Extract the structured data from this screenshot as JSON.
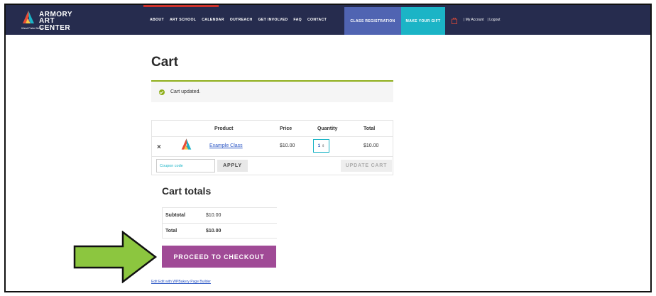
{
  "header": {
    "logo_line1": "ARMORY",
    "logo_line2": "ART CENTER",
    "logo_sub": "West Palm Beach",
    "nav": [
      "ABOUT",
      "ART SCHOOL",
      "CALENDAR",
      "OUTREACH",
      "GET INVOLVED",
      "FAQ",
      "CONTACT"
    ],
    "class_registration": "CLASS REGISTRATION",
    "make_your_gift": "MAKE YOUR GIFT",
    "my_account": "| My Account",
    "logout": "| Logout",
    "colors": {
      "bar": "#262c4e",
      "class_reg": "#5064b2",
      "gift": "#1bb4c6",
      "accent": "#d0322b"
    }
  },
  "page": {
    "title": "Cart",
    "notice": "Cart updated."
  },
  "cart": {
    "headers": {
      "product": "Product",
      "price": "Price",
      "quantity": "Quantity",
      "total": "Total"
    },
    "items": [
      {
        "remove": "×",
        "product": "Example Class",
        "price": "$10.00",
        "quantity": "1",
        "total": "$10.00"
      }
    ],
    "coupon_placeholder": "Coupon code",
    "apply": "APPLY",
    "update": "UPDATE CART"
  },
  "totals": {
    "title": "Cart totals",
    "subtotal_label": "Subtotal",
    "subtotal_value": "$10.00",
    "total_label": "Total",
    "total_value": "$10.00",
    "checkout": "PROCEED TO CHECKOUT",
    "checkout_color": "#a04a96"
  },
  "footer": {
    "edit_link": "Edit Edit with WPBakery Page Builder"
  },
  "annotation": {
    "arrow_color": "#8cc63f"
  }
}
